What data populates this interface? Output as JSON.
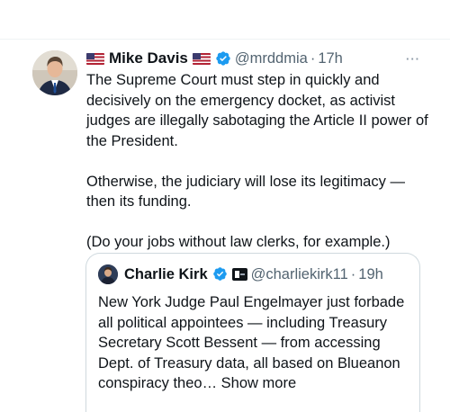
{
  "tweet": {
    "author_name": "Mike Davis",
    "handle": "@mrddmia",
    "separator": "·",
    "time": "17h",
    "more_icon": "···",
    "paragraphs": [
      "The Supreme Court must step in quickly and decisively on the emergency docket, as activist judges are illegally sabotaging the Article II power of the President.",
      "Otherwise, the judiciary will lose its legitimacy —then its funding.",
      "(Do your jobs without law clerks, for example.)"
    ]
  },
  "quote": {
    "author_name": "Charlie Kirk",
    "handle": "@charliekirk11",
    "separator": "·",
    "time": "19h",
    "text": "New York Judge Paul Engelmayer just forbade all political appointees — including Treasury Secretary Scott Bessent — from accessing Dept. of Treasury data, all based on Blueanon conspiracy theo…",
    "show_more": "Show more"
  },
  "colors": {
    "verified": "#1d9bf0",
    "secondary_text": "#536471",
    "border": "#cfd9de"
  }
}
